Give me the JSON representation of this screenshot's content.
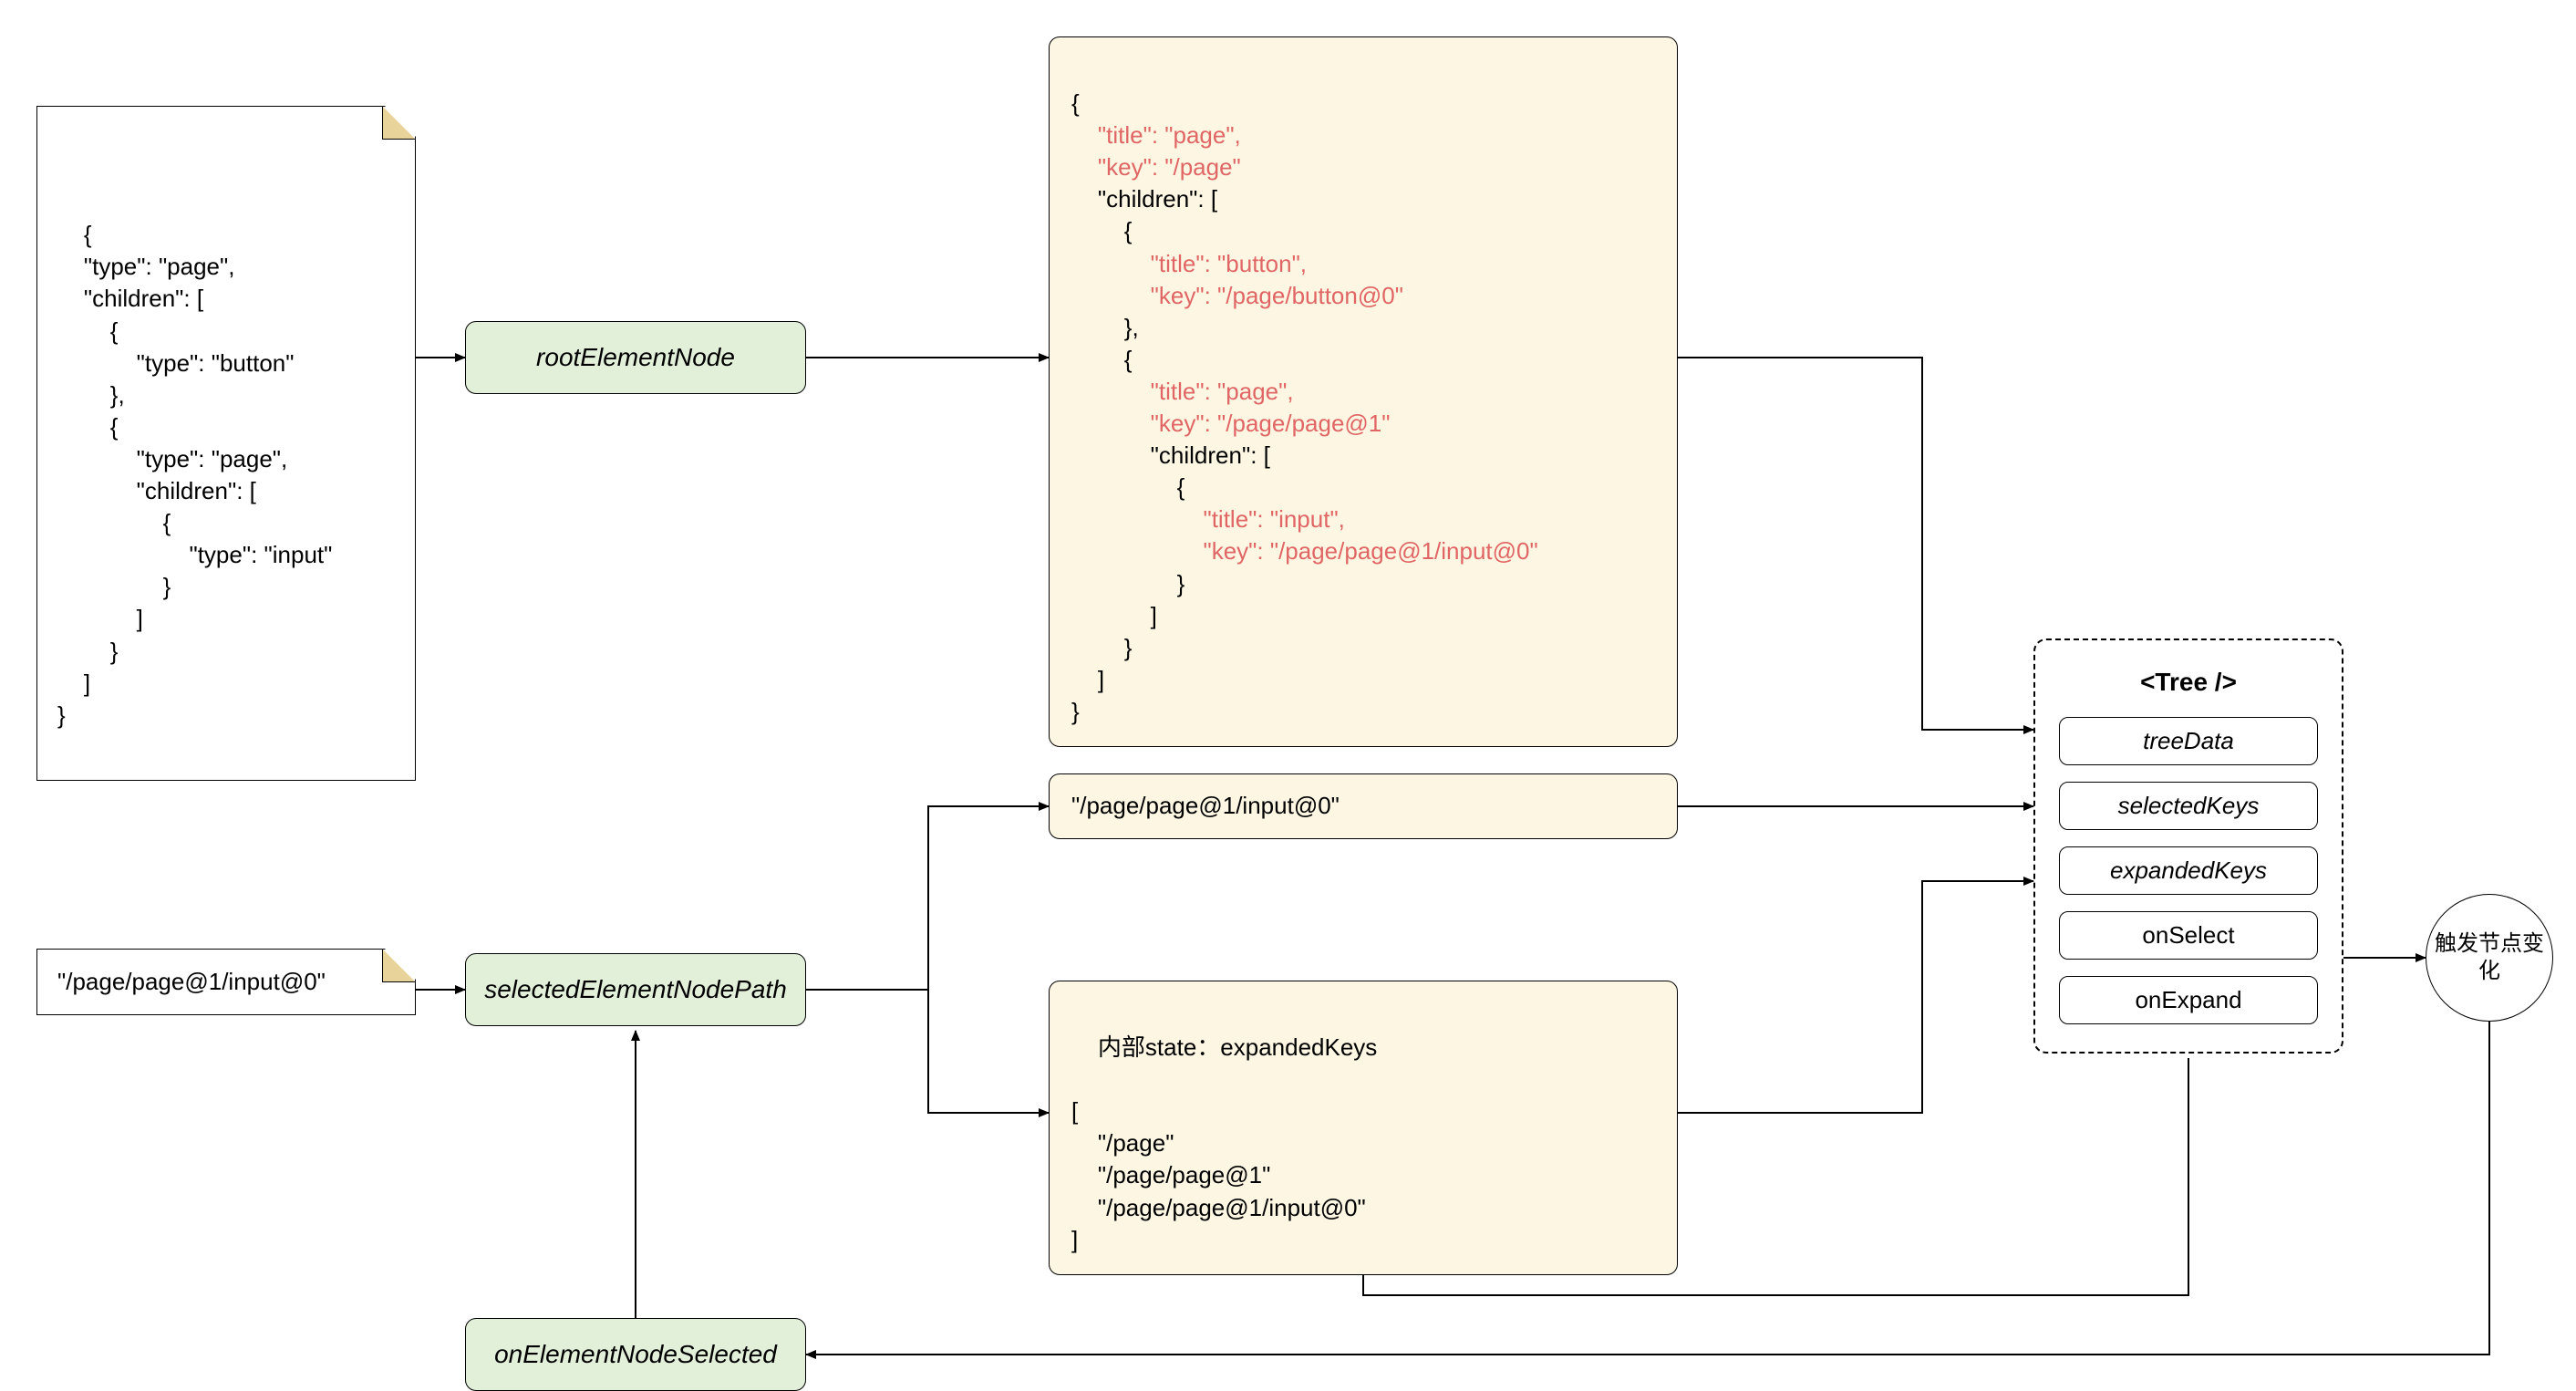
{
  "notes": {
    "inputJson": "{\n    \"type\": \"page\",\n    \"children\": [\n        {\n            \"type\": \"button\"\n        },\n        {\n            \"type\": \"page\",\n            \"children\": [\n                {\n                    \"type\": \"input\"\n                }\n            ]\n        }\n    ]\n}",
    "selectedPath": "\"/page/page@1/input@0\""
  },
  "processes": {
    "rootElementNode": "rootElementNode",
    "selectedElementNodePath": "selectedElementNodePath",
    "onElementNodeSelected": "onElementNodeSelected"
  },
  "dataBoxes": {
    "treeDataJson": {
      "line1": "{",
      "line2": "    \"title\": \"page\",",
      "line3": "    \"key\": \"/page\"",
      "line4": "    \"children\": [",
      "line5": "        {",
      "line6": "            \"title\": \"button\",",
      "line7": "            \"key\": \"/page/button@0\"",
      "line8": "        },",
      "line9": "        {",
      "line10": "            \"title\": \"page\",",
      "line11": "            \"key\": \"/page/page@1\"",
      "line12": "            \"children\": [",
      "line13": "                {",
      "line14": "                    \"title\": \"input\",",
      "line15": "                    \"key\": \"/page/page@1/input@0\"",
      "line16": "                }",
      "line17": "            ]",
      "line18": "        }",
      "line19": "    ]",
      "line20": "}"
    },
    "selectedKey": "\"/page/page@1/input@0\"",
    "expandedKeysLabel": "内部state：expandedKeys",
    "expandedKeysBody": "[\n    \"/page\"\n    \"/page/page@1\"\n    \"/page/page@1/input@0\"\n]"
  },
  "treeComponent": {
    "title": "<Tree />",
    "props": {
      "treeData": "treeData",
      "selectedKeys": "selectedKeys",
      "expandedKeys": "expandedKeys",
      "onSelect": "onSelect",
      "onExpand": "onExpand"
    }
  },
  "circle": {
    "label": "触发节点变化"
  }
}
